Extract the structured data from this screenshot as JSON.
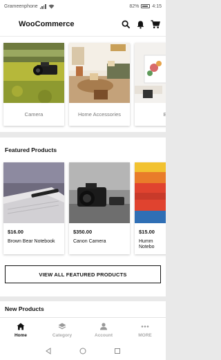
{
  "status_bar": {
    "carrier": "Grameenphone",
    "battery": "82%",
    "time": "4:15"
  },
  "app": {
    "title": "WooCommerce"
  },
  "header_icons": [
    "search-icon",
    "bell-icon",
    "cart-icon"
  ],
  "categories": [
    {
      "label": "Camera"
    },
    {
      "label": "Home Accessories"
    },
    {
      "label": "B"
    }
  ],
  "featured": {
    "title": "Featured Products",
    "products": [
      {
        "price": "$16.00",
        "name": "Brown Bear Notebook"
      },
      {
        "price": "$350.00",
        "name": "Canon Camera"
      },
      {
        "price": "$15.00",
        "name": "Humm",
        "name_line2": "Notebo"
      }
    ],
    "view_all_label": "VIEW ALL FEATURED PRODUCTS"
  },
  "new_products": {
    "title": "New Products"
  },
  "bottom_nav": {
    "items": [
      {
        "label": "Home",
        "icon": "home-icon",
        "active": true
      },
      {
        "label": "Category",
        "icon": "layers-icon",
        "active": false
      },
      {
        "label": "Account",
        "icon": "person-icon",
        "active": false
      },
      {
        "label": "MORE",
        "icon": "more-icon",
        "active": false
      }
    ]
  },
  "colors": {
    "accent": "#111111",
    "inactive": "#aaaaaa",
    "background": "#e9e9e9"
  }
}
